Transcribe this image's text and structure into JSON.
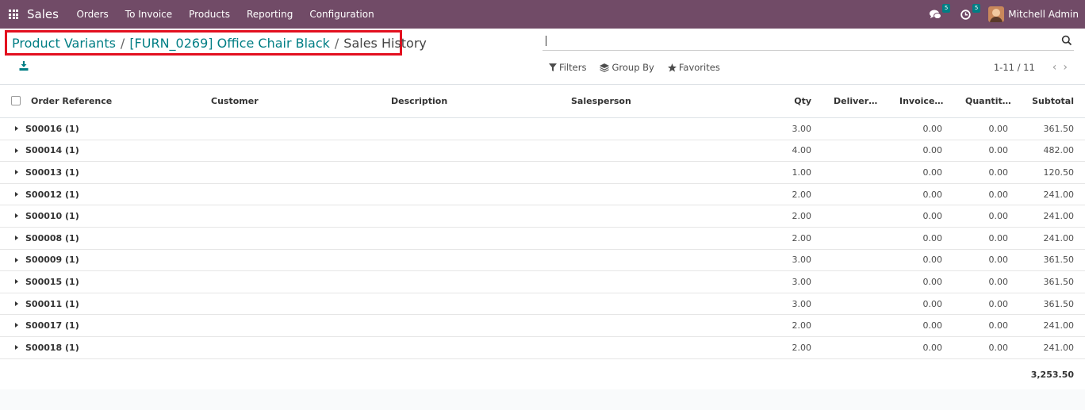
{
  "navbar": {
    "app_name": "Sales",
    "menu": [
      "Orders",
      "To Invoice",
      "Products",
      "Reporting",
      "Configuration"
    ],
    "messages_badge": "5",
    "activities_badge": "5",
    "user_name": "Mitchell Admin"
  },
  "breadcrumb": {
    "items": [
      "Product Variants",
      "[FURN_0269] Office Chair Black"
    ],
    "current": "Sales History",
    "separator": "/"
  },
  "search": {
    "placeholder": ""
  },
  "filters": {
    "filters_label": "Filters",
    "group_by_label": "Group By",
    "favorites_label": "Favorites"
  },
  "pager": {
    "value": "1-11 / 11"
  },
  "table": {
    "columns": [
      "Order Reference",
      "Customer",
      "Description",
      "Salesperson",
      "Qty",
      "Deliver…",
      "Invoice…",
      "Quantit…",
      "Subtotal"
    ],
    "groups": [
      {
        "name": "S00016 (1)",
        "qty": "3.00",
        "invoiced": "0.00",
        "quantity": "0.00",
        "subtotal": "361.50"
      },
      {
        "name": "S00014 (1)",
        "qty": "4.00",
        "invoiced": "0.00",
        "quantity": "0.00",
        "subtotal": "482.00"
      },
      {
        "name": "S00013 (1)",
        "qty": "1.00",
        "invoiced": "0.00",
        "quantity": "0.00",
        "subtotal": "120.50"
      },
      {
        "name": "S00012 (1)",
        "qty": "2.00",
        "invoiced": "0.00",
        "quantity": "0.00",
        "subtotal": "241.00"
      },
      {
        "name": "S00010 (1)",
        "qty": "2.00",
        "invoiced": "0.00",
        "quantity": "0.00",
        "subtotal": "241.00"
      },
      {
        "name": "S00008 (1)",
        "qty": "2.00",
        "invoiced": "0.00",
        "quantity": "0.00",
        "subtotal": "241.00"
      },
      {
        "name": "S00009 (1)",
        "qty": "3.00",
        "invoiced": "0.00",
        "quantity": "0.00",
        "subtotal": "361.50"
      },
      {
        "name": "S00015 (1)",
        "qty": "3.00",
        "invoiced": "0.00",
        "quantity": "0.00",
        "subtotal": "361.50"
      },
      {
        "name": "S00011 (1)",
        "qty": "3.00",
        "invoiced": "0.00",
        "quantity": "0.00",
        "subtotal": "361.50"
      },
      {
        "name": "S00017 (1)",
        "qty": "2.00",
        "invoiced": "0.00",
        "quantity": "0.00",
        "subtotal": "241.00"
      },
      {
        "name": "S00018 (1)",
        "qty": "2.00",
        "invoiced": "0.00",
        "quantity": "0.00",
        "subtotal": "241.00"
      }
    ],
    "total_subtotal": "3,253.50"
  },
  "colors": {
    "navbar": "#714b67",
    "link": "#017e84",
    "highlight_box": "#e3101f",
    "badge": "#017e84"
  }
}
